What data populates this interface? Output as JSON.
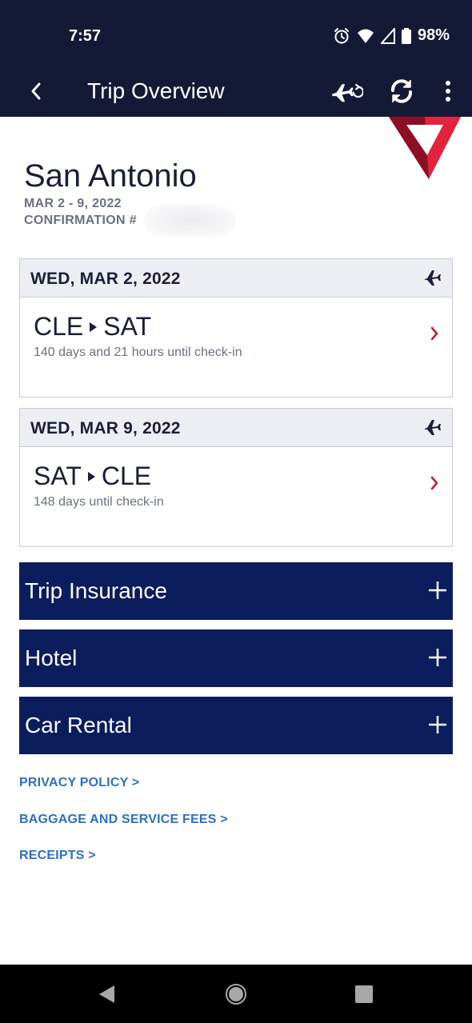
{
  "status": {
    "time": "7:57",
    "battery": "98%"
  },
  "appbar": {
    "title": "Trip Overview"
  },
  "trip": {
    "city": "San Antonio",
    "dates": "MAR 2 - 9, 2022",
    "confirmation_label": "CONFIRMATION #"
  },
  "flights": [
    {
      "date": "WED, MAR 2, 2022",
      "from": "CLE",
      "to": "SAT",
      "countdown": "140 days and 21 hours until check-in"
    },
    {
      "date": "WED, MAR 9, 2022",
      "from": "SAT",
      "to": "CLE",
      "countdown": "148 days until check-in"
    }
  ],
  "sections": [
    {
      "label": "Trip Insurance"
    },
    {
      "label": "Hotel"
    },
    {
      "label": "Car Rental"
    }
  ],
  "links": [
    {
      "label": "PRIVACY POLICY >"
    },
    {
      "label": "BAGGAGE AND SERVICE FEES >"
    },
    {
      "label": "RECEIPTS >"
    }
  ],
  "colors": {
    "header": "#141a36",
    "accordion": "#0c1d5e",
    "link": "#2c6fc6",
    "brand_red": "#c01933"
  },
  "icons": [
    "back-icon",
    "flight-status-icon",
    "refresh-icon",
    "more-vert-icon",
    "plane-icon",
    "chevron-right-icon",
    "plus-icon",
    "alarm-icon",
    "wifi-icon",
    "signal-icon",
    "battery-icon",
    "delta-logo"
  ]
}
